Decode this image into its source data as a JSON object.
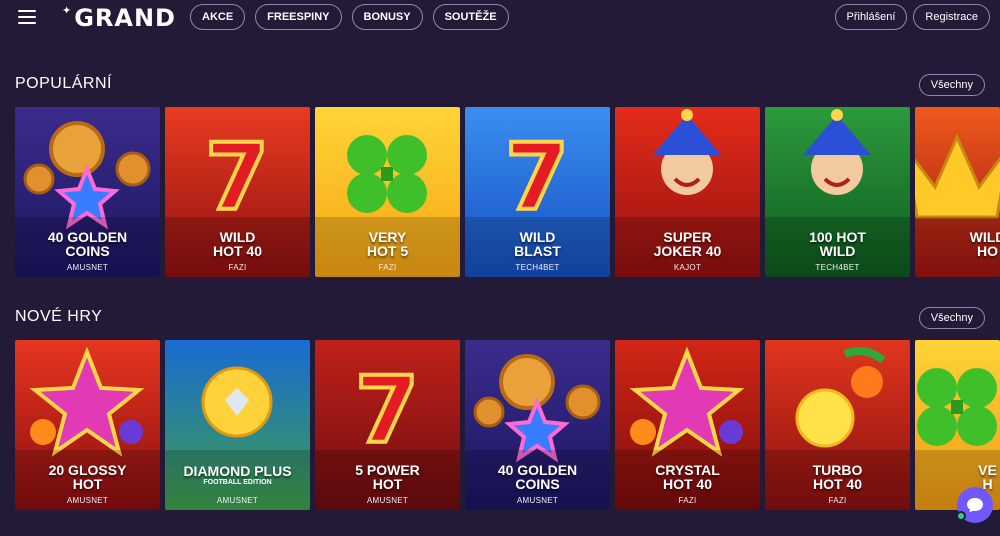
{
  "header": {
    "logo_text": "GRAND",
    "nav": [
      "AKCE",
      "FREESPINY",
      "BONUSY",
      "SOUTĚŽE"
    ],
    "login_label": "Přihlášení",
    "register_label": "Registrace"
  },
  "sections": [
    {
      "title": "POPULÁRNÍ",
      "all_label": "Všechny",
      "games": [
        {
          "line1": "40 GOLDEN",
          "line2": "COINS",
          "provider": "AMUSNET",
          "bg": [
            "#3b2c8c",
            "#1a1660"
          ]
        },
        {
          "line1": "WILD",
          "line2": "HOT 40",
          "provider": "FAZI",
          "bg": [
            "#e83c20",
            "#8e0f10"
          ]
        },
        {
          "line1": "VERY",
          "line2": "HOT 5",
          "provider": "FAZI",
          "bg": [
            "#ffd437",
            "#f6a514"
          ]
        },
        {
          "line1": "WILD",
          "line2": "BLAST",
          "provider": "TECH4BET",
          "bg": [
            "#3a8ff0",
            "#164ec0"
          ]
        },
        {
          "line1": "SUPER",
          "line2": "JOKER 40",
          "provider": "KAJOT",
          "bg": [
            "#e42c1a",
            "#921010"
          ]
        },
        {
          "line1": "100 HOT",
          "line2": "WILD",
          "provider": "TECH4BET",
          "bg": [
            "#2c9a3c",
            "#0d5a1e"
          ]
        },
        {
          "line1": "WILD",
          "line2": "HO",
          "provider": "",
          "bg": [
            "#ee5a1c",
            "#9e1412"
          ]
        }
      ]
    },
    {
      "title": "NOVÉ HRY",
      "all_label": "Všechny",
      "games": [
        {
          "line1": "20 GLOSSY",
          "line2": "HOT",
          "provider": "AMUSNET",
          "bg": [
            "#e6361f",
            "#8a0d10"
          ]
        },
        {
          "line1": "DIAMOND PLUS",
          "line2": "",
          "sub": "FOOTBALL EDITION",
          "provider": "AMUSNET",
          "bg": [
            "#1a6ad4",
            "#3fa04a"
          ]
        },
        {
          "line1": "5 POWER",
          "line2": "HOT",
          "provider": "AMUSNET",
          "bg": [
            "#c0211a",
            "#6e0c10"
          ]
        },
        {
          "line1": "40 GOLDEN",
          "line2": "COINS",
          "provider": "AMUSNET",
          "bg": [
            "#3b2c8c",
            "#1a1660"
          ]
        },
        {
          "line1": "CRYSTAL",
          "line2": "HOT 40",
          "provider": "FAZI",
          "bg": [
            "#d22616",
            "#7a0c0c"
          ]
        },
        {
          "line1": "TURBO",
          "line2": "HOT 40",
          "provider": "FAZI",
          "bg": [
            "#e0361d",
            "#8a1010"
          ]
        },
        {
          "line1": "VE",
          "line2": "H",
          "provider": "",
          "bg": [
            "#ffd437",
            "#f09a12"
          ]
        }
      ]
    }
  ],
  "colors": {
    "background": "#221a36",
    "pill_border": "#8f89a8",
    "chat": "#7057ff",
    "online": "#2fd07a"
  }
}
